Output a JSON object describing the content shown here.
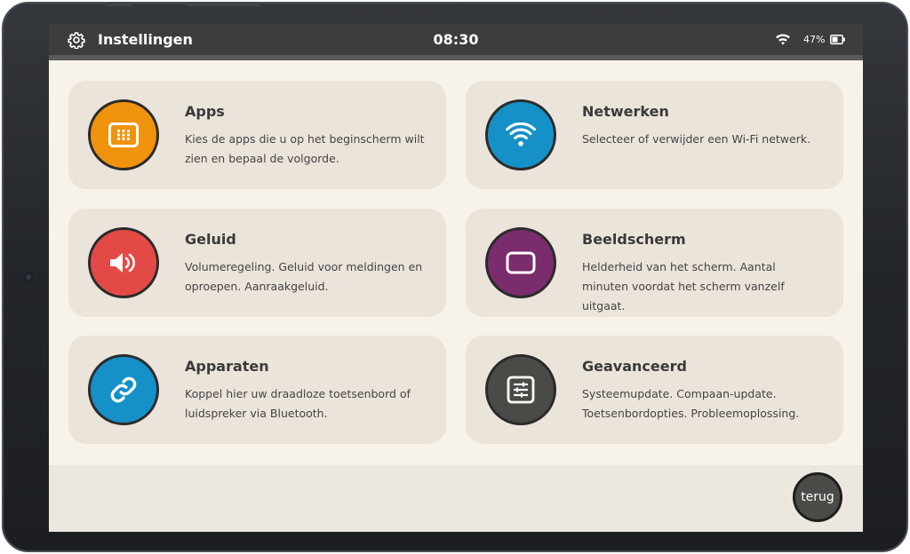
{
  "statusbar": {
    "title": "Instellingen",
    "time": "08:30",
    "battery": "47%",
    "icons": [
      "gear-icon",
      "wifi-icon",
      "battery-icon"
    ]
  },
  "cards": [
    {
      "title": "Apps",
      "description": "Kies de apps die u op het beginscherm wilt zien en bepaal de volgorde.",
      "icon": "apps-grid-icon",
      "color": "#f0930c"
    },
    {
      "title": "Netwerken",
      "description": "Selecteer of verwijder een Wi-Fi netwerk.",
      "icon": "wifi-icon",
      "color": "#1591c8"
    },
    {
      "title": "Geluid",
      "description": "Volumeregeling. Geluid voor meldingen en oproepen. Aanraakgeluid.",
      "icon": "speaker-icon",
      "color": "#e44a45"
    },
    {
      "title": "Beeldscherm",
      "description": "Helderheid van het scherm. Aantal minuten voordat het scherm vanzelf uitgaat.",
      "icon": "screen-icon",
      "color": "#7a2c6c"
    },
    {
      "title": "Apparaten",
      "description": "Koppel hier uw draadloze toetsenbord of luidspreker via Bluetooth.",
      "icon": "link-icon",
      "color": "#1591c8"
    },
    {
      "title": "Geavanceerd",
      "description": "Systeemupdate. Compaan-update. Toetsenbordopties. Probleemoplossing.",
      "icon": "sliders-icon",
      "color": "#4a4a47"
    }
  ],
  "footer": {
    "back_label": "terug"
  }
}
